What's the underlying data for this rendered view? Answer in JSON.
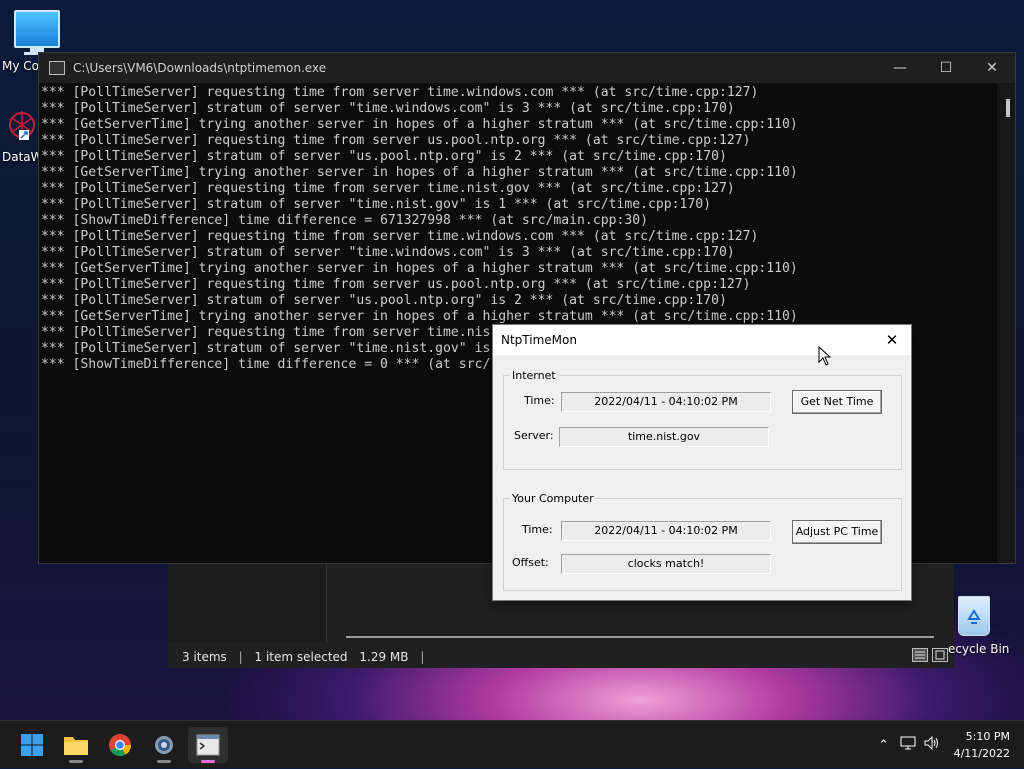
{
  "desktop": {
    "icons": [
      {
        "label": "My Co"
      },
      {
        "label": "DataW"
      }
    ],
    "recycle_label": "ecycle Bin"
  },
  "explorer": {
    "items": "3 items",
    "selected": "1 item selected",
    "size": "1.29 MB"
  },
  "console": {
    "title": "C:\\Users\\VM6\\Downloads\\ntptimemon.exe",
    "lines": [
      "*** [PollTimeServer] requesting time from server time.windows.com *** (at src/time.cpp:127)",
      "*** [PollTimeServer] stratum of server \"time.windows.com\" is 3 *** (at src/time.cpp:170)",
      "*** [GetServerTime] trying another server in hopes of a higher stratum *** (at src/time.cpp:110)",
      "*** [PollTimeServer] requesting time from server us.pool.ntp.org *** (at src/time.cpp:127)",
      "*** [PollTimeServer] stratum of server \"us.pool.ntp.org\" is 2 *** (at src/time.cpp:170)",
      "*** [GetServerTime] trying another server in hopes of a higher stratum *** (at src/time.cpp:110)",
      "*** [PollTimeServer] requesting time from server time.nist.gov *** (at src/time.cpp:127)",
      "*** [PollTimeServer] stratum of server \"time.nist.gov\" is 1 *** (at src/time.cpp:170)",
      "*** [ShowTimeDifference] time difference = 671327998 *** (at src/main.cpp:30)",
      "*** [PollTimeServer] requesting time from server time.windows.com *** (at src/time.cpp:127)",
      "*** [PollTimeServer] stratum of server \"time.windows.com\" is 3 *** (at src/time.cpp:170)",
      "*** [GetServerTime] trying another server in hopes of a higher stratum *** (at src/time.cpp:110)",
      "*** [PollTimeServer] requesting time from server us.pool.ntp.org *** (at src/time.cpp:127)",
      "*** [PollTimeServer] stratum of server \"us.pool.ntp.org\" is 2 *** (at src/time.cpp:170)",
      "*** [GetServerTime] trying another server in hopes of a higher stratum *** (at src/time.cpp:110)",
      "*** [PollTimeServer] requesting time from server time.nis",
      "*** [PollTimeServer] stratum of server \"time.nist.gov\" is",
      "*** [ShowTimeDifference] time difference = 0 *** (at src/"
    ]
  },
  "dialog": {
    "title": "NtpTimeMon",
    "internet": {
      "legend": "Internet",
      "time_label": "Time:",
      "time_value": "2022/04/11 - 04:10:02 PM",
      "server_label": "Server:",
      "server_value": "time.nist.gov",
      "button": "Get Net Time"
    },
    "computer": {
      "legend": "Your Computer",
      "time_label": "Time:",
      "time_value": "2022/04/11 - 04:10:02 PM",
      "offset_label": "Offset:",
      "offset_value": "clocks match!",
      "button": "Adjust PC Time"
    }
  },
  "taskbar": {
    "apps": [
      "start-icon",
      "file-explorer-icon",
      "chrome-icon",
      "settings-icon",
      "console-app-icon"
    ],
    "time": "5:10 PM",
    "date": "4/11/2022"
  }
}
